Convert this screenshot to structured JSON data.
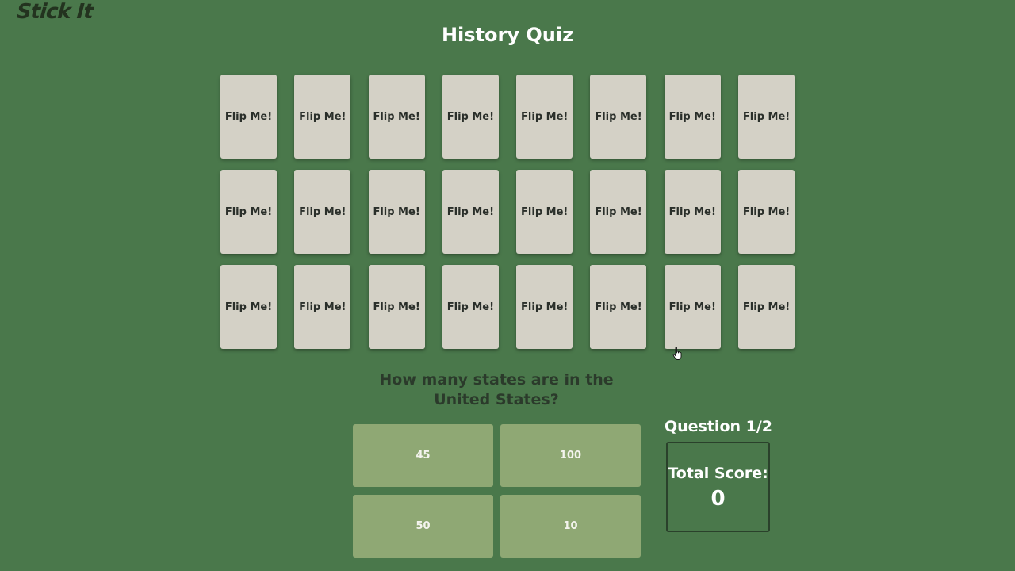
{
  "app": {
    "logo": "Stick It",
    "title": "History Quiz"
  },
  "cards": [
    {
      "label": "Flip Me!"
    },
    {
      "label": "Flip Me!"
    },
    {
      "label": "Flip Me!"
    },
    {
      "label": "Flip Me!"
    },
    {
      "label": "Flip Me!"
    },
    {
      "label": "Flip Me!"
    },
    {
      "label": "Flip Me!"
    },
    {
      "label": "Flip Me!"
    },
    {
      "label": "Flip Me!"
    },
    {
      "label": "Flip Me!"
    },
    {
      "label": "Flip Me!"
    },
    {
      "label": "Flip Me!"
    },
    {
      "label": "Flip Me!"
    },
    {
      "label": "Flip Me!"
    },
    {
      "label": "Flip Me!"
    },
    {
      "label": "Flip Me!"
    },
    {
      "label": "Flip Me!"
    },
    {
      "label": "Flip Me!"
    },
    {
      "label": "Flip Me!"
    },
    {
      "label": "Flip Me!"
    },
    {
      "label": "Flip Me!"
    },
    {
      "label": "Flip Me!"
    },
    {
      "label": "Flip Me!"
    },
    {
      "label": "Flip Me!"
    }
  ],
  "quiz": {
    "question": "How many states are in the United States?",
    "answers": [
      {
        "label": "45"
      },
      {
        "label": "100"
      },
      {
        "label": "50"
      },
      {
        "label": "10"
      }
    ],
    "counter": "Question 1/2",
    "score_label": "Total Score:",
    "score_value": "0"
  },
  "colors": {
    "background": "#4a784b",
    "card": "#d4d1c6",
    "answer": "#8fa874"
  },
  "icons": {
    "cursor": "hand-pointer-icon"
  }
}
